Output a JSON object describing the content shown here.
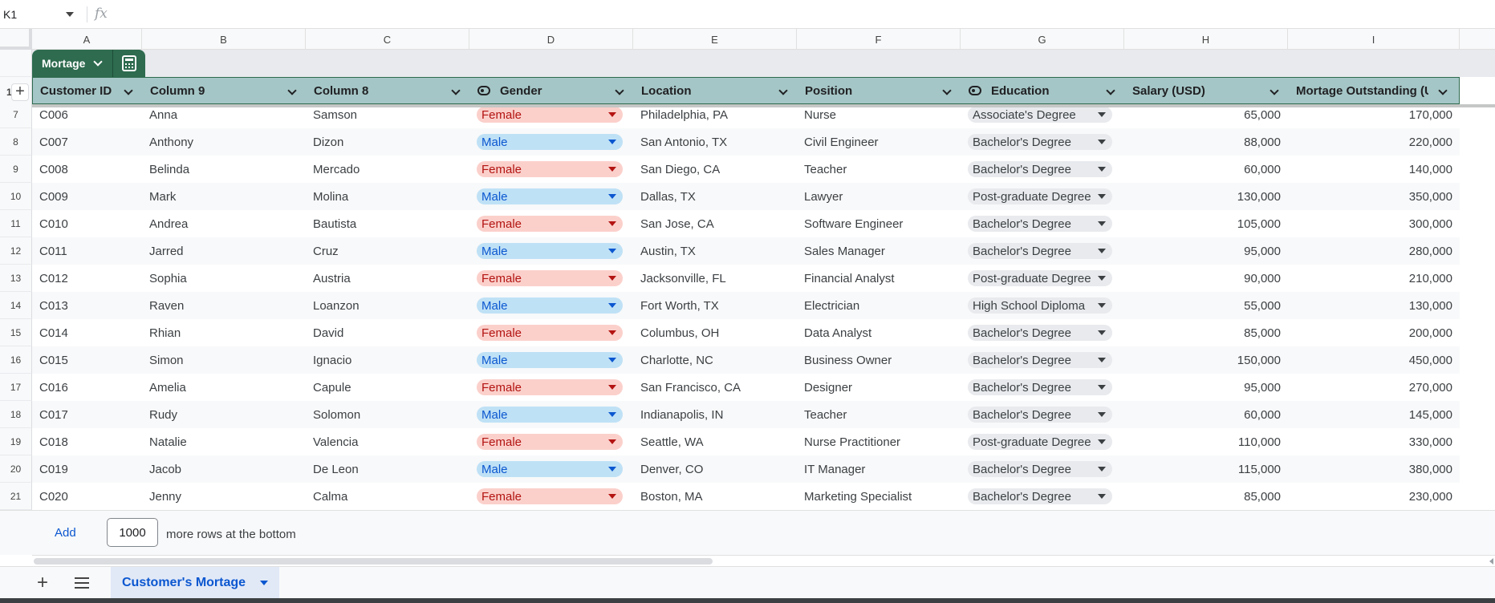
{
  "formula_bar": {
    "cell_ref": "K1",
    "fx": "fx"
  },
  "columns": [
    "A",
    "B",
    "C",
    "D",
    "E",
    "F",
    "G",
    "H",
    "I"
  ],
  "table": {
    "name": "Mortage",
    "headers": [
      "Customer ID",
      "Column 9",
      "Column 8",
      "Gender",
      "Location",
      "Position",
      "Education",
      "Salary (USD)",
      "Mortage Outstanding (USD)"
    ],
    "header_row_number": "1",
    "rows": [
      {
        "n": "7",
        "id": "C006",
        "first": "Anna",
        "last": "Samson",
        "gender": "Female",
        "location": "Philadelphia, PA",
        "position": "Nurse",
        "education": "Associate's Degree",
        "salary": "65,000",
        "mortgage": "170,000"
      },
      {
        "n": "8",
        "id": "C007",
        "first": "Anthony",
        "last": "Dizon",
        "gender": "Male",
        "location": "San Antonio, TX",
        "position": "Civil Engineer",
        "education": "Bachelor's Degree",
        "salary": "88,000",
        "mortgage": "220,000"
      },
      {
        "n": "9",
        "id": "C008",
        "first": "Belinda",
        "last": "Mercado",
        "gender": "Female",
        "location": "San Diego, CA",
        "position": "Teacher",
        "education": "Bachelor's Degree",
        "salary": "60,000",
        "mortgage": "140,000"
      },
      {
        "n": "10",
        "id": "C009",
        "first": "Mark",
        "last": "Molina",
        "gender": "Male",
        "location": "Dallas, TX",
        "position": "Lawyer",
        "education": "Post-graduate Degree",
        "salary": "130,000",
        "mortgage": "350,000"
      },
      {
        "n": "11",
        "id": "C010",
        "first": "Andrea",
        "last": "Bautista",
        "gender": "Female",
        "location": "San Jose, CA",
        "position": "Software Engineer",
        "education": "Bachelor's Degree",
        "salary": "105,000",
        "mortgage": "300,000"
      },
      {
        "n": "12",
        "id": "C011",
        "first": "Jarred",
        "last": "Cruz",
        "gender": "Male",
        "location": "Austin, TX",
        "position": "Sales Manager",
        "education": "Bachelor's Degree",
        "salary": "95,000",
        "mortgage": "280,000"
      },
      {
        "n": "13",
        "id": "C012",
        "first": "Sophia",
        "last": "Austria",
        "gender": "Female",
        "location": "Jacksonville, FL",
        "position": "Financial Analyst",
        "education": "Post-graduate Degree",
        "salary": "90,000",
        "mortgage": "210,000"
      },
      {
        "n": "14",
        "id": "C013",
        "first": "Raven",
        "last": "Loanzon",
        "gender": "Male",
        "location": "Fort Worth, TX",
        "position": "Electrician",
        "education": "High School Diploma",
        "salary": "55,000",
        "mortgage": "130,000"
      },
      {
        "n": "15",
        "id": "C014",
        "first": "Rhian",
        "last": "David",
        "gender": "Female",
        "location": "Columbus, OH",
        "position": "Data Analyst",
        "education": "Bachelor's Degree",
        "salary": "85,000",
        "mortgage": "200,000"
      },
      {
        "n": "16",
        "id": "C015",
        "first": "Simon",
        "last": "Ignacio",
        "gender": "Male",
        "location": "Charlotte, NC",
        "position": "Business Owner",
        "education": "Bachelor's Degree",
        "salary": "150,000",
        "mortgage": "450,000"
      },
      {
        "n": "17",
        "id": "C016",
        "first": "Amelia",
        "last": "Capule",
        "gender": "Female",
        "location": "San Francisco, CA",
        "position": "Designer",
        "education": "Bachelor's Degree",
        "salary": "95,000",
        "mortgage": "270,000"
      },
      {
        "n": "18",
        "id": "C017",
        "first": "Rudy",
        "last": "Solomon",
        "gender": "Male",
        "location": "Indianapolis, IN",
        "position": "Teacher",
        "education": "Bachelor's Degree",
        "salary": "60,000",
        "mortgage": "145,000"
      },
      {
        "n": "19",
        "id": "C018",
        "first": "Natalie",
        "last": "Valencia",
        "gender": "Female",
        "location": "Seattle, WA",
        "position": "Nurse Practitioner",
        "education": "Post-graduate Degree",
        "salary": "110,000",
        "mortgage": "330,000"
      },
      {
        "n": "20",
        "id": "C019",
        "first": "Jacob",
        "last": "De Leon",
        "gender": "Male",
        "location": "Denver, CO",
        "position": "IT Manager",
        "education": "Bachelor's Degree",
        "salary": "115,000",
        "mortgage": "380,000"
      },
      {
        "n": "21",
        "id": "C020",
        "first": "Jenny",
        "last": "Calma",
        "gender": "Female",
        "location": "Boston, MA",
        "position": "Marketing Specialist",
        "education": "Bachelor's Degree",
        "salary": "85,000",
        "mortgage": "230,000"
      }
    ]
  },
  "add_rows": {
    "button": "Add",
    "count": "1000",
    "suffix": "more rows at the bottom"
  },
  "sheet_tab": {
    "label": "Customer's Mortage"
  },
  "colors": {
    "table_accent": "#2e6b4f",
    "header_bg": "#a5c6c6",
    "female_bg": "#fbd0cb",
    "male_bg": "#bfe1f6",
    "edu_bg": "#e8eaed"
  }
}
